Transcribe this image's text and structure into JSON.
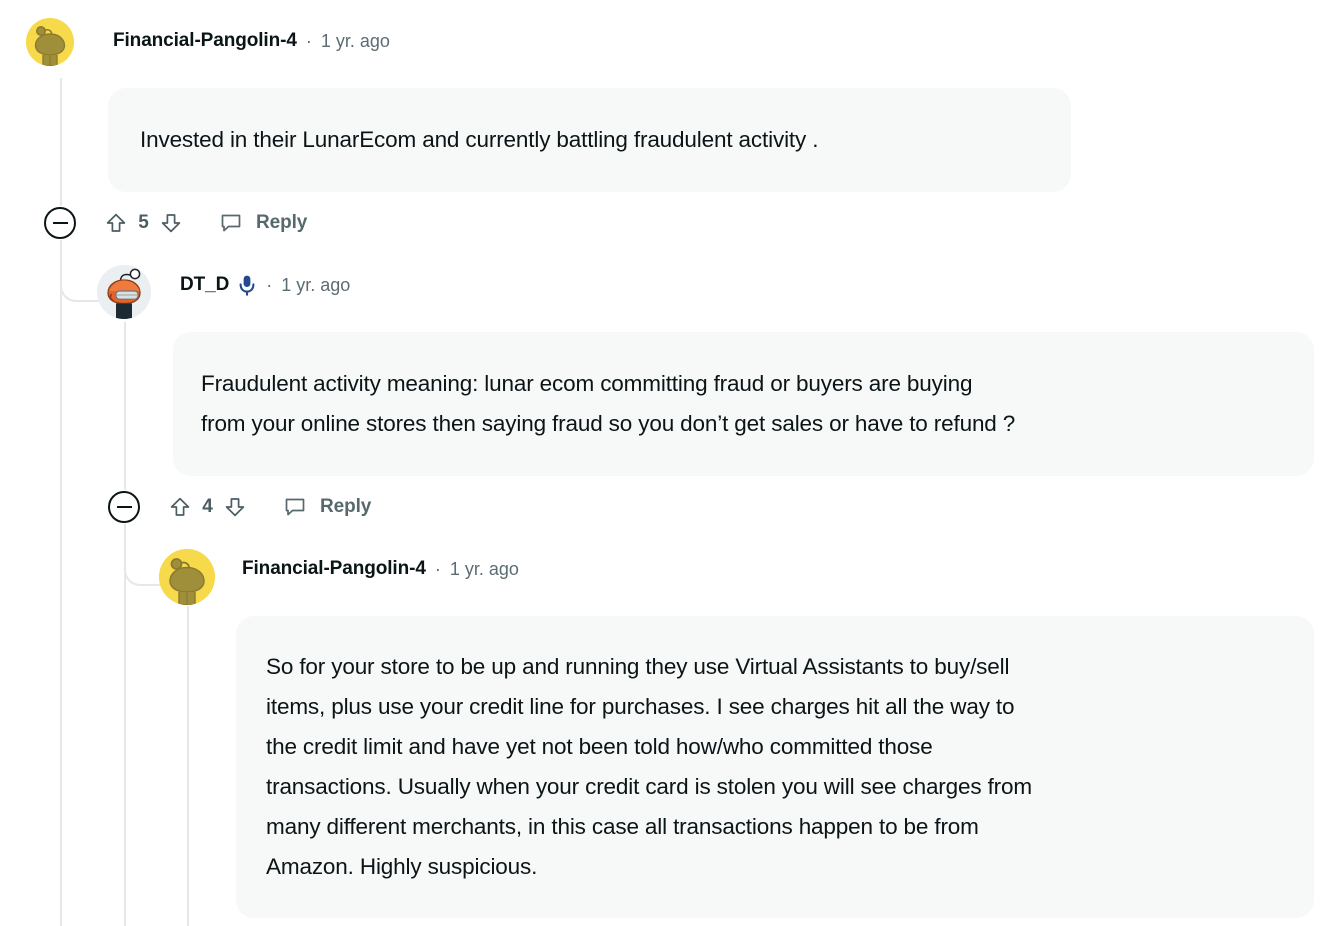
{
  "thread": {
    "line_color": "#e5e7e8",
    "bubble_color": "#f7f8f8",
    "text_color": "#0b1416",
    "meta_color": "#5c6c74",
    "action_color": "#57696f",
    "op_badge_color": "#24498f"
  },
  "comments": [
    {
      "author": "Financial-Pangolin-4",
      "separator": "·",
      "timestamp": "1 yr. ago",
      "avatar": "snoo-yellow-avatar",
      "is_op": false,
      "body": "Invested in their LunarEcom and currently battling fraudulent activity .",
      "score": "5",
      "reply_label": "Reply",
      "collapse_icon": "minus-circle-icon",
      "upvote_icon": "upvote-arrow-icon",
      "downvote_icon": "downvote-arrow-icon",
      "reply_icon": "comment-bubble-icon"
    },
    {
      "author": "DT_D",
      "separator": "·",
      "timestamp": "1 yr. ago",
      "avatar": "snoo-orange-helmet-avatar",
      "is_op": true,
      "op_icon": "microphone-icon",
      "body_line_1": "Fraudulent activity meaning: lunar ecom committing fraud or buyers are buying",
      "body_line_2": "from your online stores then saying fraud so you don’t get sales or have to refund ?",
      "score": "4",
      "reply_label": "Reply",
      "collapse_icon": "minus-circle-icon",
      "upvote_icon": "upvote-arrow-icon",
      "downvote_icon": "downvote-arrow-icon",
      "reply_icon": "comment-bubble-icon"
    },
    {
      "author": "Financial-Pangolin-4",
      "separator": "·",
      "timestamp": "1 yr. ago",
      "avatar": "snoo-yellow-avatar",
      "is_op": false,
      "body_line_1": "So for your store to be up and running they use Virtual Assistants to buy/sell",
      "body_line_2": "items, plus use your credit line for purchases. I see charges hit all the way to",
      "body_line_3": "the credit limit and have yet not been told how/who committed those",
      "body_line_4": "transactions. Usually when your credit card is stolen you will see charges from",
      "body_line_5": "many different merchants, in this case all transactions happen to be from",
      "body_line_6": "Amazon. Highly suspicious."
    }
  ]
}
